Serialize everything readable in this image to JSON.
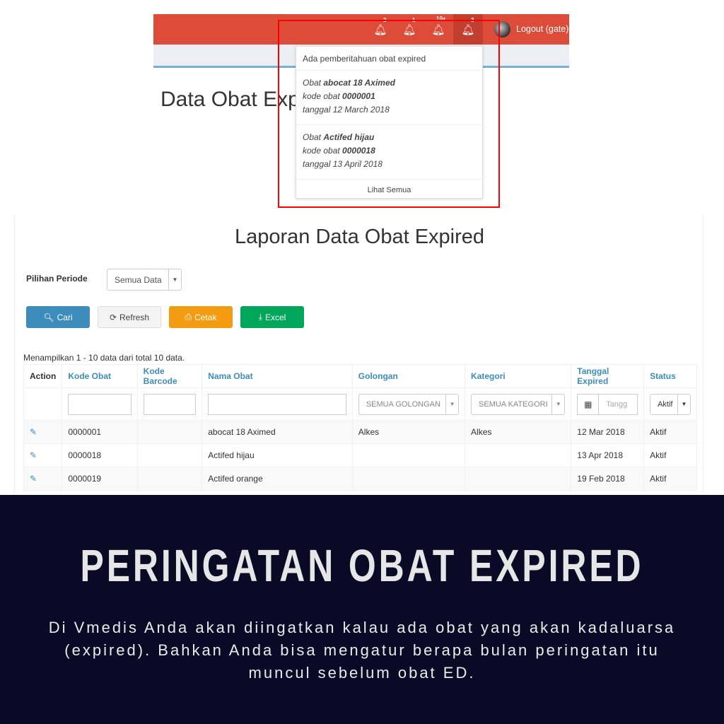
{
  "topbar": {
    "bells": [
      {
        "badge": "2"
      },
      {
        "badge": "1"
      },
      {
        "badge": "10+"
      },
      {
        "badge": "3"
      }
    ],
    "logout": "Logout (gate)"
  },
  "page_title": "Data Obat Expired",
  "notifications": {
    "header": "Ada pemberitahuan obat expired",
    "items": [
      {
        "prefix": "Obat ",
        "name": "abocat 18 Aximed",
        "kode_label": "kode obat ",
        "kode": "0000001",
        "tanggal": "tanggal 12 March 2018"
      },
      {
        "prefix": "Obat ",
        "name": "Actifed hijau",
        "kode_label": "kode obat ",
        "kode": "0000018",
        "tanggal": "tanggal 13 April 2018"
      }
    ],
    "footer": "Lihat Semua"
  },
  "report": {
    "title": "Laporan Data Obat Expired",
    "periode_label": "Pilihan Periode",
    "periode_value": "Semua Data",
    "buttons": {
      "cari": "Cari",
      "refresh": "Refresh",
      "cetak": "Cetak",
      "excel": "Excel"
    },
    "colors": {
      "cari": "#3c8dbc",
      "cetak": "#f39c12",
      "excel": "#00a65a"
    },
    "info": "Menampilkan 1 - 10 data dari total 10 data.",
    "columns": [
      "Action",
      "Kode Obat",
      "Kode Barcode",
      "Nama Obat",
      "Golongan",
      "Kategori",
      "Tanggal Expired",
      "Status"
    ],
    "filters": {
      "golongan": "SEMUA GOLONGAN",
      "kategori": "SEMUA KATEGORI",
      "tanggal_placeholder": "Tangg",
      "status": "Aktif"
    },
    "rows": [
      [
        "0000001",
        "",
        "abocat 18 Aximed",
        "Alkes",
        "Alkes",
        "12 Mar 2018",
        "Aktif"
      ],
      [
        "0000018",
        "",
        "Actifed hijau",
        "",
        "",
        "13 Apr 2018",
        "Aktif"
      ],
      [
        "0000019",
        "",
        "Actifed orange",
        "",
        "",
        "19 Feb 2018",
        "Aktif"
      ]
    ]
  },
  "banner": {
    "title": "PERINGATAN OBAT EXPIRED",
    "description": "Di Vmedis Anda akan diingatkan kalau ada obat yang akan kadaluarsa (expired). Bahkan Anda bisa mengatur berapa bulan peringatan itu muncul sebelum obat ED."
  }
}
